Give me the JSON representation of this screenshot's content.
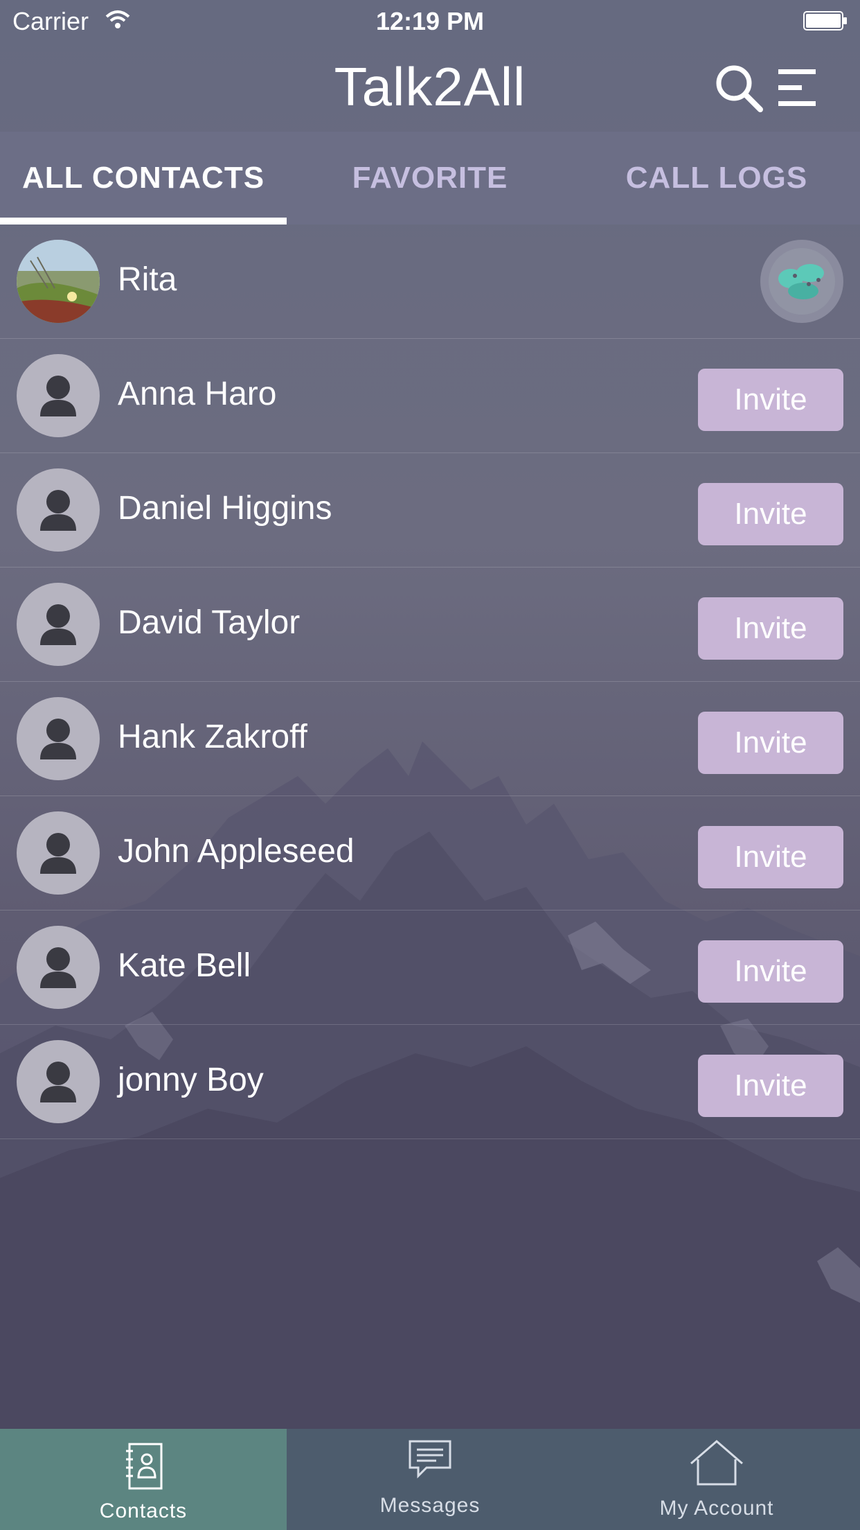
{
  "status_bar": {
    "carrier": "Carrier",
    "time": "12:19 PM"
  },
  "header": {
    "title": "Talk2All",
    "search_icon": "search-icon",
    "menu_icon": "menu-icon"
  },
  "tabs": [
    {
      "label": "ALL CONTACTS",
      "active": true
    },
    {
      "label": "FAVORITE",
      "active": false
    },
    {
      "label": "CALL LOGS",
      "active": false
    }
  ],
  "contacts": [
    {
      "name": "Rita",
      "avatar": "photo-avatar",
      "action": "app-user-badge-icon"
    },
    {
      "name": "Anna Haro",
      "avatar": "person-icon",
      "action_label": "Invite"
    },
    {
      "name": "Daniel Higgins",
      "avatar": "person-icon",
      "action_label": "Invite"
    },
    {
      "name": "David Taylor",
      "avatar": "person-icon",
      "action_label": "Invite"
    },
    {
      "name": "Hank Zakroff",
      "avatar": "person-icon",
      "action_label": "Invite"
    },
    {
      "name": "John Appleseed",
      "avatar": "person-icon",
      "action_label": "Invite"
    },
    {
      "name": "Kate Bell",
      "avatar": "person-icon",
      "action_label": "Invite"
    },
    {
      "name": "jonny Boy",
      "avatar": "person-icon",
      "action_label": "Invite"
    }
  ],
  "tab_bar": [
    {
      "label": "Contacts",
      "icon": "contacts-book-icon",
      "active": true
    },
    {
      "label": "Messages",
      "icon": "message-bubble-icon",
      "active": false
    },
    {
      "label": "My Account",
      "icon": "home-icon",
      "active": false
    }
  ],
  "colors": {
    "invite_button": "#c8b5d6",
    "tab_bar_active": "#5c8581",
    "tab_inactive_text": "#c6bfe0"
  }
}
